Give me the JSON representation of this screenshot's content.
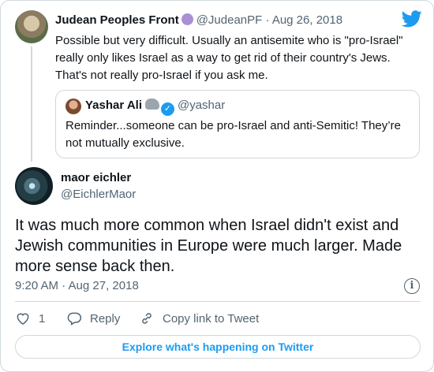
{
  "parent_tweet": {
    "display_name": "Judean Peoples Front",
    "handle": "@JudeanPF",
    "date": "· Aug 26, 2018",
    "text": "Possible but very difficult. Usually an antisemite who is \"pro-Israel\" really only likes Israel as a way to get rid of their country's Jews. That's not really pro-Israel if you ask me.",
    "name_emoji": "purple-circle-emoji"
  },
  "quoted_tweet": {
    "display_name": "Yashar Ali",
    "handle": "@yashar",
    "text": "Reminder...someone can be pro-Israel and anti-Semitic! They’re not mutually exclusive.",
    "name_emoji": "elephant-emoji",
    "verified": true
  },
  "main_tweet": {
    "display_name": "maor eichler",
    "handle": "@EichlerMaor",
    "text": "It was much more common when Israel didn't exist and Jewish communities in Europe were much larger. Made more sense back then.",
    "timestamp": "9:20 AM · Aug 27, 2018"
  },
  "actions": {
    "like_count": "1",
    "reply_label": "Reply",
    "copy_link_label": "Copy link to Tweet"
  },
  "explore_label": "Explore what's happening on Twitter",
  "colors": {
    "brand": "#1d9bf0",
    "text": "#0f1419",
    "muted": "#536471",
    "border": "#cfd9de"
  }
}
